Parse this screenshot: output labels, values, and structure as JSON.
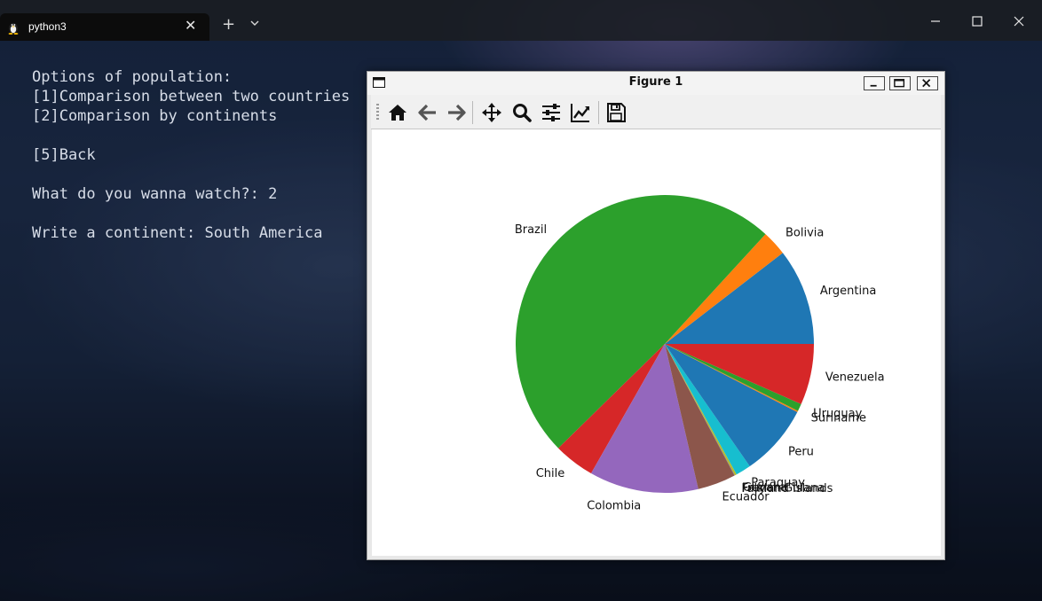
{
  "terminal": {
    "tab_title": "python3",
    "lines": [
      "Options of population:",
      "[1]Comparison between two countries",
      "[2]Comparison by continents",
      "",
      "[5]Back",
      "",
      "What do you wanna watch?: 2",
      "",
      "Write a continent: South America"
    ]
  },
  "icons": {
    "tab_icon": "linux-penguin-icon",
    "tab_close": "close-icon",
    "new_tab": "plus-icon",
    "dropdown": "chevron-down-icon",
    "minimize": "minimize-icon",
    "maximize": "maximize-icon",
    "close": "close-icon"
  },
  "figure": {
    "title": "Figure 1",
    "toolbar": [
      "home-icon",
      "back-arrow-icon",
      "forward-arrow-icon",
      "pan-icon",
      "zoom-icon",
      "configure-subplots-icon",
      "edit-axis-icon",
      "save-icon"
    ]
  },
  "chart_data": {
    "type": "pie",
    "title": "",
    "start_angle_deg": 0,
    "direction": "counterclockwise",
    "labels": [
      "Argentina",
      "Bolivia",
      "Brazil",
      "Chile",
      "Colombia",
      "Ecuador",
      "Falkland Islands",
      "French Guiana",
      "Guyana",
      "Paraguay",
      "Peru",
      "Suriname",
      "Uruguay",
      "Venezuela"
    ],
    "values": [
      45.4,
      11.8,
      213.0,
      19.2,
      51.3,
      17.9,
      0.003,
      0.3,
      0.8,
      7.2,
      33.7,
      0.6,
      3.5,
      28.7
    ],
    "colors": [
      "#1f77b4",
      "#ff7f0e",
      "#2ca02c",
      "#d62728",
      "#9467bd",
      "#8c564b",
      "#e377c2",
      "#7f7f7f",
      "#bcbd22",
      "#17becf",
      "#1f77b4",
      "#ff7f0e",
      "#2ca02c",
      "#d62728"
    ]
  }
}
